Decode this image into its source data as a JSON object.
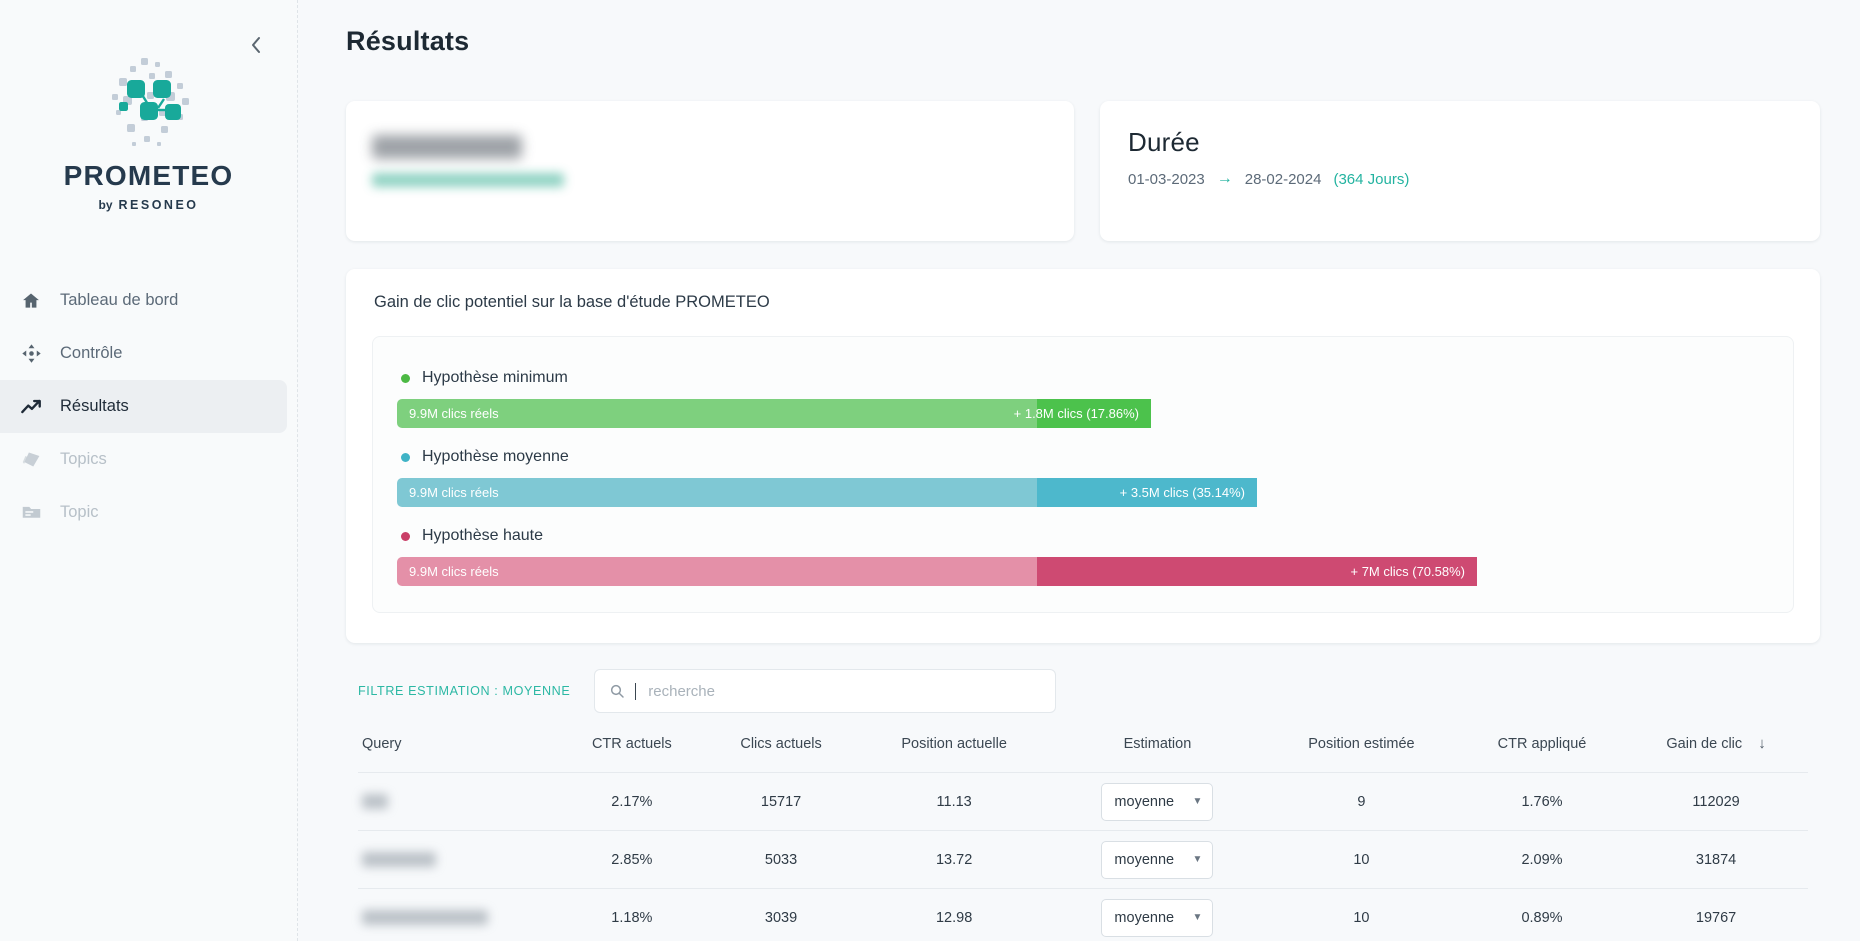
{
  "sidebar": {
    "collapse_icon": "chevron-left-icon",
    "logo": {
      "wordmark": "PROMETEO",
      "by_label": "by",
      "brand": "RESONEO"
    },
    "items": [
      {
        "label": "Tableau de bord",
        "icon": "home-icon",
        "state": "default"
      },
      {
        "label": "Contrôle",
        "icon": "move-icon",
        "state": "default"
      },
      {
        "label": "Résultats",
        "icon": "trending-up-icon",
        "state": "active"
      },
      {
        "label": "Topics",
        "icon": "layers-icon",
        "state": "disabled"
      },
      {
        "label": "Topic",
        "icon": "folder-icon",
        "state": "disabled"
      }
    ]
  },
  "page": {
    "title": "Résultats"
  },
  "site_card": {
    "name_redacted": true,
    "url_redacted": true
  },
  "duree_card": {
    "title": "Durée",
    "start_date": "01-03-2023",
    "arrow": "→",
    "end_date": "28-02-2024",
    "days": "(364 Jours)"
  },
  "gain_panel": {
    "title": "Gain de clic potentiel sur la base d'étude PROMETEO"
  },
  "chart_data": {
    "type": "bar",
    "title": "Gain de clic potentiel sur la base d'étude PROMETEO",
    "orientation": "horizontal-stacked",
    "base_label": "9.9M clics réels",
    "base_value": 9900000,
    "categories": [
      "Hypothèse minimum",
      "Hypothèse moyenne",
      "Hypothèse haute"
    ],
    "series": [
      {
        "name": "Hypothèse minimum",
        "base_label": "9.9M clics réels",
        "gain_label": "+ 1.8M clics (17.86%)",
        "gain_value": 1800000,
        "gain_percent": 17.86,
        "base_color": "#7ed07e",
        "gain_color": "#4cc24c",
        "dot_color": "#4cb944"
      },
      {
        "name": "Hypothèse moyenne",
        "base_label": "9.9M clics réels",
        "gain_label": "+ 3.5M clics (35.14%)",
        "gain_value": 3500000,
        "gain_percent": 35.14,
        "base_color": "#7fc8d4",
        "gain_color": "#4db8cc",
        "dot_color": "#3fb3c6"
      },
      {
        "name": "Hypothèse haute",
        "base_label": "9.9M clics réels",
        "gain_label": "+ 7M clics (70.58%)",
        "gain_value": 7000000,
        "gain_percent": 70.58,
        "base_color": "#e490a8",
        "gain_color": "#ce4a72",
        "dot_color": "#c93f67"
      }
    ]
  },
  "filter": {
    "label": "FILTRE ESTIMATION : MOYENNE",
    "search_placeholder": "recherche",
    "search_value": "",
    "search_icon": "search-icon"
  },
  "table": {
    "columns": [
      "Query",
      "CTR actuels",
      "Clics actuels",
      "Position actuelle",
      "Estimation",
      "Position estimée",
      "CTR appliqué",
      "Gain de clic"
    ],
    "sort_column": "Gain de clic",
    "sort_icon": "arrow-down-icon",
    "rows": [
      {
        "query_redacted": true,
        "query_blur_width": 26,
        "ctr_actuels": "2.17%",
        "clics_actuels": "15717",
        "position_actuelle": "11.13",
        "estimation": "moyenne",
        "position_estimee": "9",
        "ctr_applique": "1.76%",
        "gain_de_clic": "112029"
      },
      {
        "query_redacted": true,
        "query_blur_width": 74,
        "ctr_actuels": "2.85%",
        "clics_actuels": "5033",
        "position_actuelle": "13.72",
        "estimation": "moyenne",
        "position_estimee": "10",
        "ctr_applique": "2.09%",
        "gain_de_clic": "31874"
      },
      {
        "query_redacted": true,
        "query_blur_width": 126,
        "ctr_actuels": "1.18%",
        "clics_actuels": "3039",
        "position_actuelle": "12.98",
        "estimation": "moyenne",
        "position_estimee": "10",
        "ctr_applique": "0.89%",
        "gain_de_clic": "19767"
      }
    ]
  },
  "colors": {
    "accent": "#23b3a0",
    "brand_dark": "#263a4d",
    "page_bg": "#f7f9fb"
  }
}
